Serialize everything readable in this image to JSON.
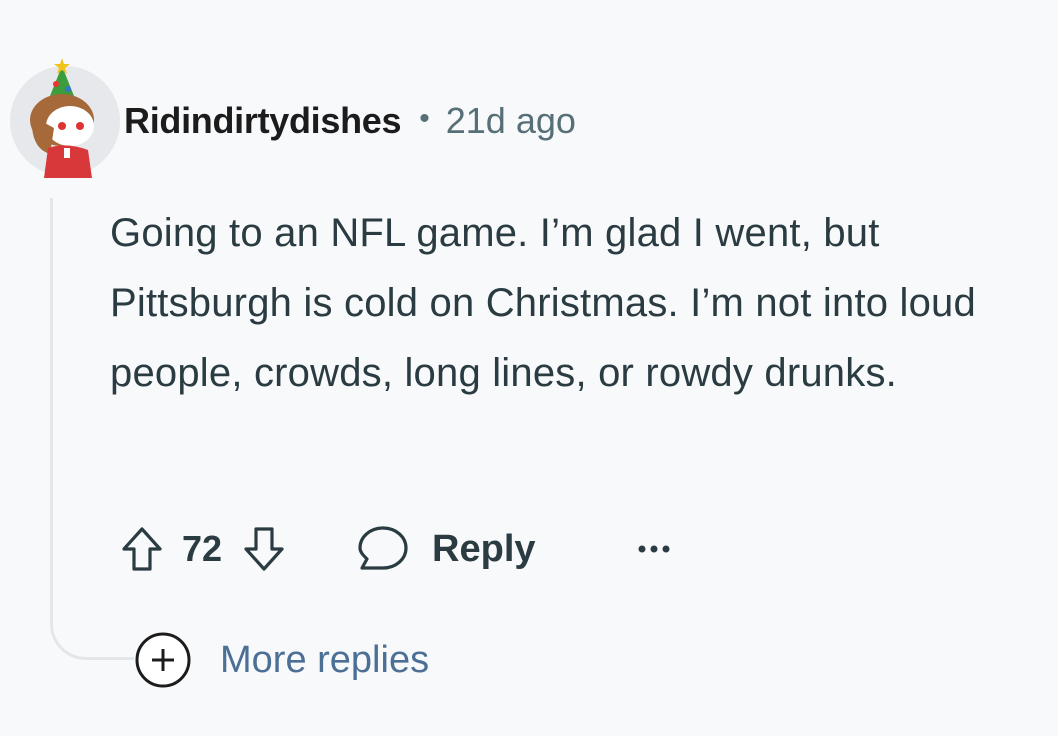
{
  "comment": {
    "username": "Ridindirtydishes",
    "separator": "•",
    "timestamp": "21d ago",
    "body": "Going to an NFL game. I’m glad I went, but Pittsburgh is cold on Christmas. I’m not into loud people, crowds, long lines, or rowdy drunks.",
    "score": "72",
    "reply_label": "Reply",
    "more_replies_label": "More replies"
  },
  "icons": {
    "upvote": "upvote-icon",
    "downvote": "downvote-icon",
    "reply": "speech-bubble-icon",
    "overflow": "ellipsis-icon",
    "expand": "plus-circle-icon"
  },
  "colors": {
    "background": "#f8f9fb",
    "text": "#2a3c42",
    "meta": "#576f76",
    "link": "#4c6f95",
    "thread_line": "#e3e7ea"
  }
}
